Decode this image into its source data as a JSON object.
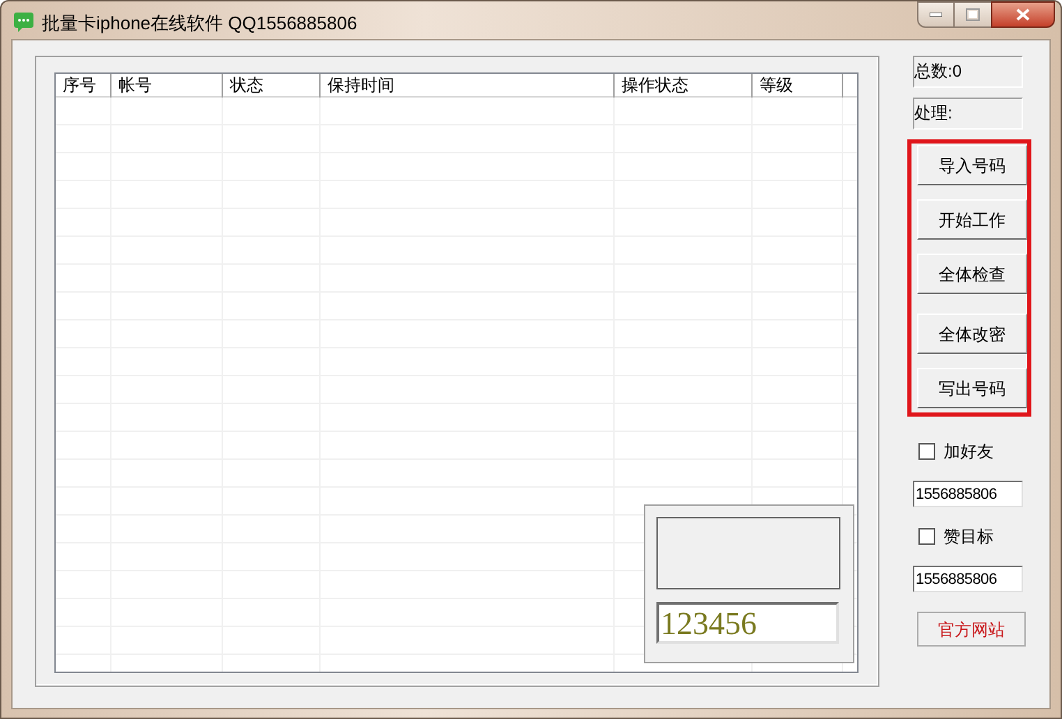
{
  "window": {
    "title": "批量卡iphone在线软件 QQ1556885806"
  },
  "table": {
    "columns": [
      {
        "label": "序号"
      },
      {
        "label": "帐号"
      },
      {
        "label": "状态"
      },
      {
        "label": "保持时间"
      },
      {
        "label": "操作状态"
      },
      {
        "label": "等级"
      }
    ]
  },
  "captcha": {
    "value": "123456"
  },
  "stats": [
    "总数:0",
    "处理:"
  ],
  "buttons": [
    "导入号码",
    "开始工作",
    "全体检查",
    "全体改密",
    "写出号码"
  ],
  "options": [
    {
      "label": "加好友",
      "checked": false,
      "value": "1556885806"
    },
    {
      "label": "赞目标",
      "checked": false,
      "value": "1556885806"
    }
  ],
  "link_button": "官方网站"
}
